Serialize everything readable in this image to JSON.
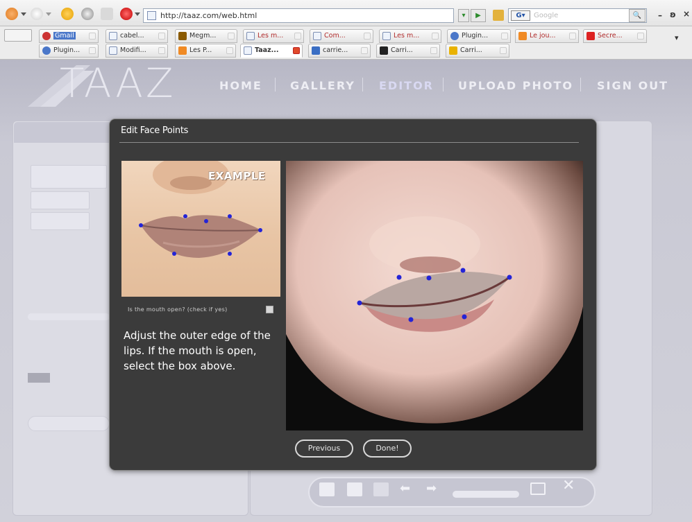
{
  "browser": {
    "url": "http://taaz.com/web.html",
    "search_placeholder": "Google",
    "search_engine_label": "G"
  },
  "tabs_row1": [
    {
      "label": "Gmail",
      "color": "#c33"
    },
    {
      "label": "cabel...",
      "color": "#7d8fb3"
    },
    {
      "label": "Megm...",
      "color": "#8a5a00"
    },
    {
      "label": "Les m...",
      "color": "#7d8fb3"
    },
    {
      "label": "Com...",
      "color": "#7d8fb3"
    },
    {
      "label": "Les m...",
      "color": "#7d8fb3"
    },
    {
      "label": "Plugin...",
      "color": "#4a77c9"
    },
    {
      "label": "Le jou...",
      "color": "#f08a24"
    },
    {
      "label": "Secre...",
      "color": "#d22"
    }
  ],
  "tabs_row2": [
    {
      "label": "Plugin...",
      "color": "#4a77c9"
    },
    {
      "label": "Modifi...",
      "color": "#7d8fb3"
    },
    {
      "label": "Les P...",
      "color": "#f08a24"
    },
    {
      "label": "Taaz...",
      "color": "#7d8fb3"
    },
    {
      "label": "carrie...",
      "color": "#3a6ec4"
    },
    {
      "label": "Carri...",
      "color": "#222"
    },
    {
      "label": "Carri...",
      "color": "#e9b200"
    }
  ],
  "site": {
    "logo": "TAAZ",
    "nav": [
      "HOME",
      "GALLERY",
      "EDITOR",
      "UPLOAD PHOTO",
      "SIGN OUT"
    ]
  },
  "dialog": {
    "title": "Edit Face Points",
    "example_label": "EXAMPLE",
    "mouth_open_label": "Is the mouth open? (check if yes)",
    "instructions": "Adjust the outer edge of the lips. If the mouth is open, select the box above.",
    "previous_label": "Previous",
    "done_label": "Done!"
  },
  "colors": {
    "dialog_bg": "#3b3b3b",
    "face_point": "#2424d6"
  }
}
